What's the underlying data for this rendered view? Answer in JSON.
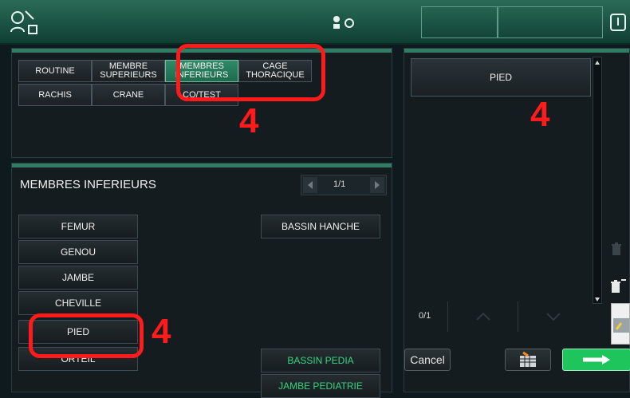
{
  "top_bar": {
    "icons": {
      "user_edit": "user-edit-icon",
      "center": "user-status-icon",
      "power": "power-icon"
    }
  },
  "categories": {
    "routine": "ROUTINE",
    "membres_sup": "MEMBRE SUPERIEURS",
    "membres_inf": "MEMBRES INFERIEURS",
    "cage_thoracique": "CAGE THORACIQUE",
    "rachis": "RACHIS",
    "crane": "CRANE",
    "cotest": "CO/TEST"
  },
  "subsection": {
    "title": "MEMBRES INFERIEURS",
    "page_indicator": "1/1",
    "left_column": [
      "FEMUR",
      "GENOU",
      "JAMBE",
      "CHEVILLE",
      "PIED",
      "ORTEIL"
    ],
    "right_column": [
      "BASSIN HANCHE"
    ],
    "pediatric": [
      "BASSIN PEDIA",
      "JAMBE PEDIATRIE"
    ]
  },
  "right_panel": {
    "selected_item": "PIED",
    "count": "0/1",
    "cancel_label": "Cancel",
    "icons": {
      "trash": "trash-icon",
      "trash_all": "trash-all-icon",
      "grid": "grid-icon",
      "arrow": "arrow-right-icon",
      "up": "chevron-up-icon",
      "down": "chevron-down-icon"
    }
  },
  "overlay": {
    "labels": [
      "4",
      "4",
      "4"
    ],
    "colors": {
      "red": "#ff1b1b",
      "accent_green": "#1ec55d"
    }
  }
}
